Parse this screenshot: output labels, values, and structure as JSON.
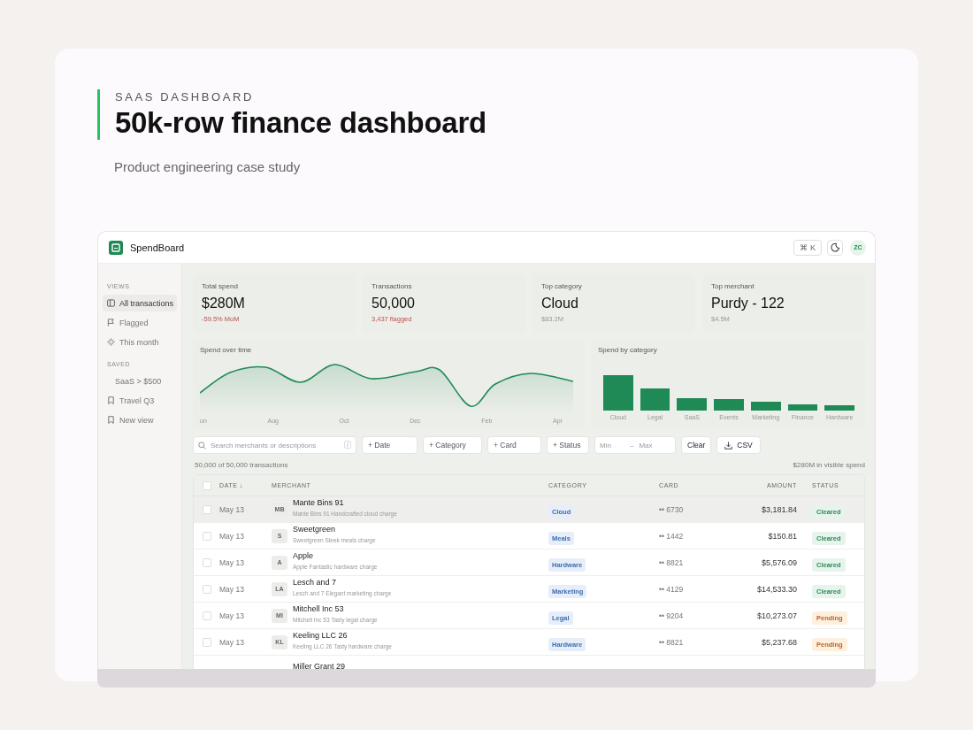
{
  "header": {
    "eyebrow": "SAAS DASHBOARD",
    "title": "50k-row finance dashboard",
    "subtitle": "Product engineering case study"
  },
  "app": {
    "name": "SpendBoard",
    "shortcut": "⌘ K",
    "avatar": "ZC"
  },
  "sidebar": {
    "sections": [
      {
        "title": "VIEWS",
        "items": [
          {
            "label": "All transactions",
            "selected": true
          },
          {
            "label": "Flagged",
            "selected": false
          },
          {
            "label": "This month",
            "selected": false
          }
        ]
      },
      {
        "title": "SAVED",
        "items": [
          {
            "label": "SaaS > $500",
            "selected": false
          },
          {
            "label": "Travel Q3",
            "selected": false
          },
          {
            "label": "New view",
            "selected": false
          }
        ]
      }
    ]
  },
  "stats": [
    {
      "label": "Total spend",
      "value": "$280M",
      "note": "-59.5% MoM",
      "alert": true
    },
    {
      "label": "Transactions",
      "value": "50,000",
      "note": "3,437 flagged",
      "alert": true
    },
    {
      "label": "Top category",
      "value": "Cloud",
      "note": "$83.2M",
      "alert": false
    },
    {
      "label": "Top merchant",
      "value": "Purdy - 122",
      "note": "$4.5M",
      "alert": false
    }
  ],
  "spend_over_time": {
    "title": "Spend over time",
    "axis_labels": [
      "un",
      "Aug",
      "Oct",
      "Dec",
      "Feb",
      "Apr"
    ]
  },
  "spend_by_category": {
    "title": "Spend by category",
    "categories": [
      "Cloud",
      "Legal",
      "SaaS",
      "Events",
      "Marketing",
      "Finance",
      "Hardware"
    ]
  },
  "filters": {
    "search_placeholder": "Search merchants or descriptions",
    "search_key": "/",
    "chips": [
      "+ Date",
      "+ Category",
      "+ Card",
      "+ Status"
    ],
    "min_placeholder": "Min",
    "range_separator": "–",
    "max_placeholder": "Max",
    "clear": "Clear",
    "export": "CSV"
  },
  "summary": {
    "count": "50,000 of 50,000 transactions",
    "visible_spend": "$280M in visible spend"
  },
  "table": {
    "select_all_checked": false,
    "columns": [
      "DATE ↓",
      "MERCHANT",
      "CATEGORY",
      "CARD",
      "AMOUNT",
      "STATUS"
    ],
    "rows": [
      {
        "checked": false,
        "highlighted": true,
        "date": "May 13",
        "initials": "MB",
        "merchant": "Mante Bins 91",
        "description": "Mante Bins 91 Handcrafted cloud charge",
        "category": "Cloud",
        "card": "•• 6730",
        "amount": "$3,181.84",
        "status": {
          "label": "Cleared",
          "kind": "cleared"
        }
      },
      {
        "checked": false,
        "highlighted": false,
        "date": "May 13",
        "initials": "S",
        "merchant": "Sweetgreen",
        "description": "Sweetgreen Sleek meals charge",
        "category": "Meals",
        "card": "•• 1442",
        "amount": "$150.81",
        "status": {
          "label": "Cleared",
          "kind": "cleared"
        }
      },
      {
        "checked": false,
        "highlighted": false,
        "date": "May 13",
        "initials": "A",
        "merchant": "Apple",
        "description": "Apple Fantastic hardware charge",
        "category": "Hardware",
        "card": "•• 8821",
        "amount": "$5,576.09",
        "status": {
          "label": "Cleared",
          "kind": "cleared"
        }
      },
      {
        "checked": false,
        "highlighted": false,
        "date": "May 13",
        "initials": "LA",
        "merchant": "Lesch and 7",
        "description": "Lesch and 7 Elegant marketing charge",
        "category": "Marketing",
        "card": "•• 4129",
        "amount": "$14,533.30",
        "status": {
          "label": "Cleared",
          "kind": "cleared"
        }
      },
      {
        "checked": false,
        "highlighted": false,
        "date": "May 13",
        "initials": "MI",
        "merchant": "Mitchell Inc 53",
        "description": "Mitchell Inc 53 Tasty legal charge",
        "category": "Legal",
        "card": "•• 9204",
        "amount": "$10,273.07",
        "status": {
          "label": "Pending",
          "kind": "pending"
        }
      },
      {
        "checked": false,
        "highlighted": false,
        "date": "May 13",
        "initials": "KL",
        "merchant": "Keeling LLC 26",
        "description": "Keeling LLC 26 Tasty hardware charge",
        "category": "Hardware",
        "card": "•• 8821",
        "amount": "$5,237.68",
        "status": {
          "label": "Pending",
          "kind": "pending"
        }
      }
    ],
    "cut_row": {
      "merchant": "Miller Grant 29"
    }
  }
}
